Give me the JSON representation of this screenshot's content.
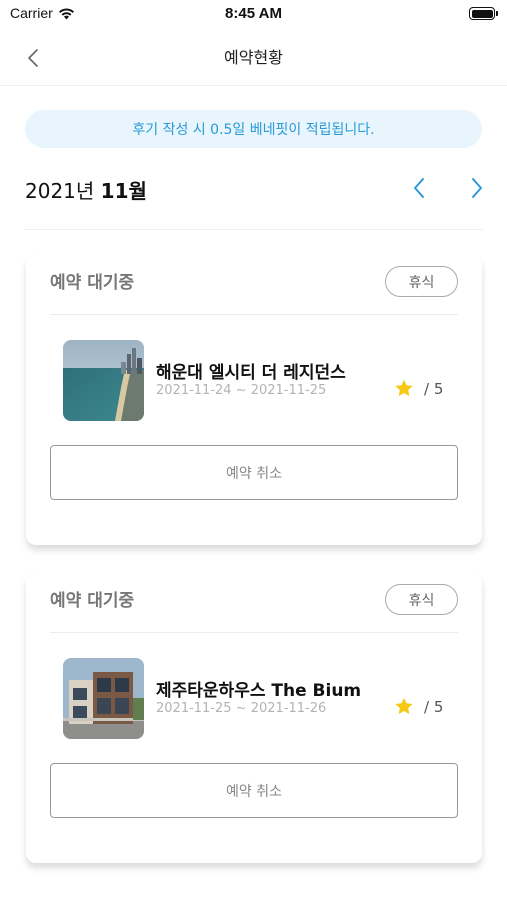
{
  "status_bar": {
    "carrier": "Carrier",
    "time": "8:45 AM"
  },
  "nav": {
    "title": "예약현황"
  },
  "banner": {
    "text": "후기 작성 시 0.5일 베네핏이 적립됩니다."
  },
  "month": {
    "year_label": "2021년",
    "month_label": "11월"
  },
  "colors": {
    "accent": "#2a9ad8",
    "banner_bg": "#e8f5fd",
    "star": "#f6c915"
  },
  "reservations": [
    {
      "status": "예약 대기중",
      "badge": "휴식",
      "name": "해운대 엘시티 더 레지던스",
      "dates": "2021-11-24 ~ 2021-11-25",
      "rating": "/ 5",
      "cancel_label": "예약 취소"
    },
    {
      "status": "예약 대기중",
      "badge": "휴식",
      "name": "제주타운하우스 The Bium",
      "dates": "2021-11-25 ~ 2021-11-26",
      "rating": "/ 5",
      "cancel_label": "예약 취소"
    }
  ]
}
